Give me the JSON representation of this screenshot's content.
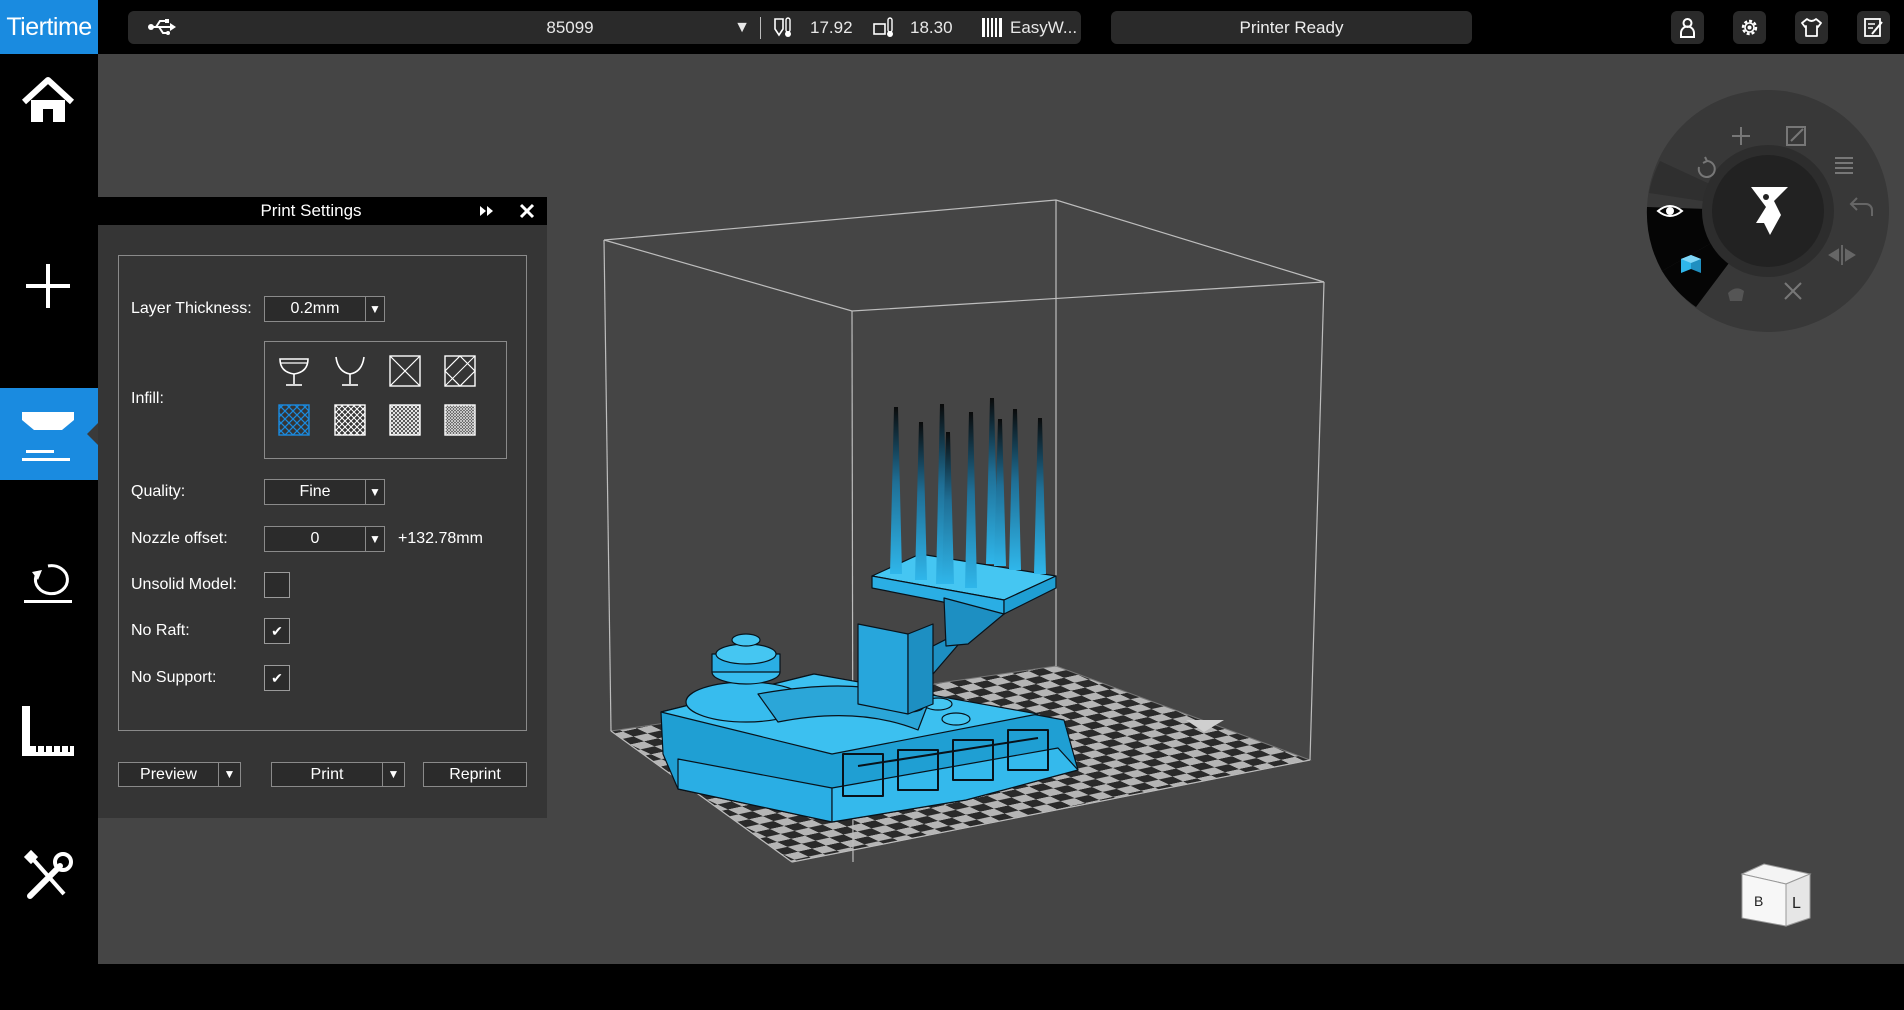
{
  "app": {
    "logo": "Tiertime"
  },
  "topbar": {
    "printer_id": "85099",
    "dropdown_glyph": "▼",
    "nozzle_temp": "17.92",
    "bed_temp": "18.30",
    "material": "EasyW...",
    "status": "Printer Ready",
    "icons": [
      "usb-icon",
      "nozzle-thermometer-icon",
      "bed-thermometer-icon",
      "filament-icon",
      "account-icon",
      "gear-icon",
      "shirt-icon",
      "edit-icon"
    ]
  },
  "sidebar": {
    "items": [
      {
        "name": "home",
        "icon": "home-icon",
        "active": false
      },
      {
        "name": "add",
        "icon": "plus-icon",
        "active": false
      },
      {
        "name": "print",
        "icon": "print-icon",
        "active": true
      },
      {
        "name": "calibrate",
        "icon": "calibrate-icon",
        "active": false
      },
      {
        "name": "measure",
        "icon": "ruler-icon",
        "active": false
      },
      {
        "name": "tools",
        "icon": "tools-icon",
        "active": false
      }
    ]
  },
  "panel": {
    "title": "Print Settings",
    "layer_thickness_label": "Layer Thickness:",
    "layer_thickness_value": "0.2mm",
    "infill_label": "Infill:",
    "infill_options": [
      "shell",
      "surface",
      "large-cell",
      "diagonal-cell",
      "fine-cross",
      "medium-cross",
      "dense-cross",
      "solid"
    ],
    "infill_selected": 4,
    "quality_label": "Quality:",
    "quality_value": "Fine",
    "nozzle_offset_label": "Nozzle offset:",
    "nozzle_offset_value": "0",
    "nozzle_offset_extra": "+132.78mm",
    "unsolid_label": "Unsolid Model:",
    "unsolid_checked": false,
    "no_raft_label": "No Raft:",
    "no_raft_checked": true,
    "no_support_label": "No Support:",
    "no_support_checked": true,
    "check_glyph": "✔",
    "arrow_glyph": "▼",
    "preview_label": "Preview",
    "print_label": "Print",
    "reprint_label": "Reprint"
  },
  "viewcube": {
    "left": "B",
    "right": "L"
  },
  "colors": {
    "accent": "#1a8be0",
    "model": "#2fb6ea",
    "viewport": "#454545"
  }
}
